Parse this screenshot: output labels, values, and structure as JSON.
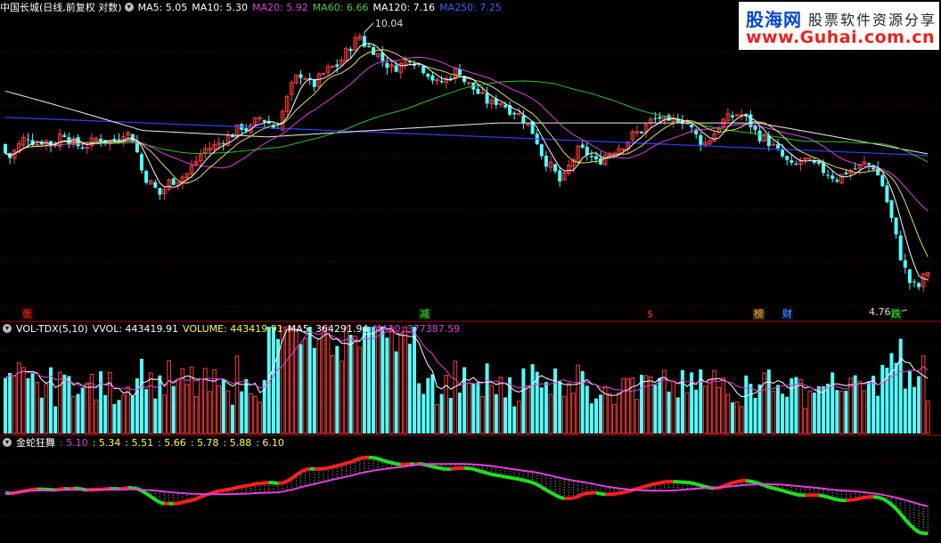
{
  "header_main": {
    "stock": "中国长城(日线,前复权 对数)",
    "icon": "circle-down-icon",
    "items": [
      {
        "label": "MA5: 5.05",
        "color": "#ffffff"
      },
      {
        "label": "MA10: 5.30",
        "color": "#ffffff"
      },
      {
        "label": "MA20: 5.92",
        "color": "#e040e0"
      },
      {
        "label": "MA60: 6.66",
        "color": "#40d040"
      },
      {
        "label": "MA120: 7.16",
        "color": "#ffffff"
      },
      {
        "label": "MA250: 7.25",
        "color": "#4060ff"
      }
    ]
  },
  "header_vol": {
    "name": "VOL-TDX(5,10)",
    "items": [
      {
        "label": "VVOL: 443419.91",
        "color": "#ffffff"
      },
      {
        "label": "VOLUME: 443419.91",
        "color": "#ffff40"
      },
      {
        "label": "MA5: 364291.94",
        "color": "#ffffff"
      },
      {
        "label": "MA10: 377387.59",
        "color": "#e040e0"
      }
    ]
  },
  "header_ind": {
    "name": "金蛇狂舞",
    "items": [
      {
        "label": ": 5.10",
        "color": "#e040e0"
      },
      {
        "label": ": 5.34",
        "color": "#ffff40"
      },
      {
        "label": ": 5.51",
        "color": "#ffff40"
      },
      {
        "label": ": 5.66",
        "color": "#ffff40"
      },
      {
        "label": ": 5.78",
        "color": "#ffff40"
      },
      {
        "label": ": 5.88",
        "color": "#ffff40"
      },
      {
        "label": ": 6.10",
        "color": "#ffff40"
      }
    ]
  },
  "logo": {
    "cn": "股海网",
    "slogan": "股票软件资源分享",
    "url": "www.Guhai.com.cn"
  },
  "markers": [
    {
      "text": "张",
      "color": "#ff3030",
      "bg": "#400000",
      "at": 24
    },
    {
      "text": "减",
      "color": "#40e040",
      "bg": "#003000",
      "at": 470
    },
    {
      "text": "$",
      "color": "#ff3030",
      "bg": "",
      "at": 725
    },
    {
      "text": "榜",
      "color": "#ffaa40",
      "bg": "#403000",
      "at": 845
    },
    {
      "text": "财",
      "color": "#60a0ff",
      "bg": "#001040",
      "at": 877
    },
    {
      "text": "跌",
      "color": "#40e040",
      "bg": "#003000",
      "at": 999
    }
  ],
  "annotations": {
    "high": "10.04",
    "low": "4.76"
  },
  "colors": {
    "up": "#ff3c3c",
    "down": "#54fcfc",
    "grid": "#800000"
  },
  "chart_data": {
    "type": "candlestick",
    "price_scale": "log",
    "high_label": 10.04,
    "low_label": 4.76,
    "ma_latest": {
      "MA5": 5.05,
      "MA10": 5.3,
      "MA20": 5.92,
      "MA60": 6.66,
      "MA120": 7.16,
      "MA250": 7.25
    },
    "volume_latest": {
      "VVOL": 443419.91,
      "VOLUME": 443419.91,
      "MA5": 364291.94,
      "MA10": 377387.59
    },
    "indicator_latest": [
      5.1,
      5.34,
      5.51,
      5.66,
      5.78,
      5.88,
      6.1
    ],
    "close_path": [
      [
        0,
        7.3
      ],
      [
        10,
        7.0
      ],
      [
        20,
        7.25
      ],
      [
        30,
        7.5
      ],
      [
        40,
        7.3
      ],
      [
        50,
        7.4
      ],
      [
        60,
        7.25
      ],
      [
        70,
        7.6
      ],
      [
        80,
        7.35
      ],
      [
        90,
        7.25
      ],
      [
        100,
        7.3
      ],
      [
        110,
        7.45
      ],
      [
        120,
        7.35
      ],
      [
        130,
        7.4
      ],
      [
        140,
        7.6
      ],
      [
        150,
        7.4
      ],
      [
        160,
        6.7
      ],
      [
        170,
        6.5
      ],
      [
        180,
        6.3
      ],
      [
        190,
        6.55
      ],
      [
        200,
        6.6
      ],
      [
        210,
        6.7
      ],
      [
        220,
        6.95
      ],
      [
        230,
        7.2
      ],
      [
        240,
        7.25
      ],
      [
        250,
        7.4
      ],
      [
        260,
        7.5
      ],
      [
        270,
        7.7
      ],
      [
        280,
        7.6
      ],
      [
        290,
        7.9
      ],
      [
        300,
        7.8
      ],
      [
        310,
        7.6
      ],
      [
        320,
        8.2
      ],
      [
        330,
        8.8
      ],
      [
        340,
        9.0
      ],
      [
        350,
        8.6
      ],
      [
        360,
        8.9
      ],
      [
        370,
        9.1
      ],
      [
        380,
        9.2
      ],
      [
        390,
        9.6
      ],
      [
        400,
        9.9
      ],
      [
        405,
        10.04
      ],
      [
        410,
        9.7
      ],
      [
        420,
        9.6
      ],
      [
        430,
        9.3
      ],
      [
        440,
        9.1
      ],
      [
        450,
        9.2
      ],
      [
        460,
        9.4
      ],
      [
        470,
        9.2
      ],
      [
        480,
        9.0
      ],
      [
        490,
        8.7
      ],
      [
        500,
        8.8
      ],
      [
        510,
        9.0
      ],
      [
        515,
        9.1
      ],
      [
        520,
        8.8
      ],
      [
        530,
        8.6
      ],
      [
        540,
        8.4
      ],
      [
        550,
        8.2
      ],
      [
        560,
        8.3
      ],
      [
        570,
        8.1
      ],
      [
        580,
        8.0
      ],
      [
        590,
        7.8
      ],
      [
        600,
        7.5
      ],
      [
        610,
        7.0
      ],
      [
        620,
        6.8
      ],
      [
        630,
        6.5
      ],
      [
        640,
        6.9
      ],
      [
        650,
        7.2
      ],
      [
        660,
        7.1
      ],
      [
        670,
        6.9
      ],
      [
        680,
        7.1
      ],
      [
        690,
        7.2
      ],
      [
        700,
        7.3
      ],
      [
        710,
        7.5
      ],
      [
        720,
        7.6
      ],
      [
        730,
        7.8
      ],
      [
        740,
        7.9
      ],
      [
        750,
        7.7
      ],
      [
        760,
        7.9
      ],
      [
        770,
        7.8
      ],
      [
        780,
        7.5
      ],
      [
        790,
        7.3
      ],
      [
        800,
        7.5
      ],
      [
        810,
        7.8
      ],
      [
        820,
        7.9
      ],
      [
        830,
        8.0
      ],
      [
        840,
        7.8
      ],
      [
        850,
        7.5
      ],
      [
        860,
        7.4
      ],
      [
        870,
        7.2
      ],
      [
        880,
        7.0
      ],
      [
        890,
        6.8
      ],
      [
        900,
        7.0
      ],
      [
        910,
        6.9
      ],
      [
        920,
        6.8
      ],
      [
        930,
        6.7
      ],
      [
        940,
        6.6
      ],
      [
        950,
        6.75
      ],
      [
        960,
        6.8
      ],
      [
        970,
        6.9
      ],
      [
        980,
        6.85
      ],
      [
        990,
        6.5
      ],
      [
        1000,
        5.9
      ],
      [
        1010,
        5.3
      ],
      [
        1020,
        4.9
      ],
      [
        1030,
        4.8
      ],
      [
        1040,
        5.05
      ]
    ]
  }
}
